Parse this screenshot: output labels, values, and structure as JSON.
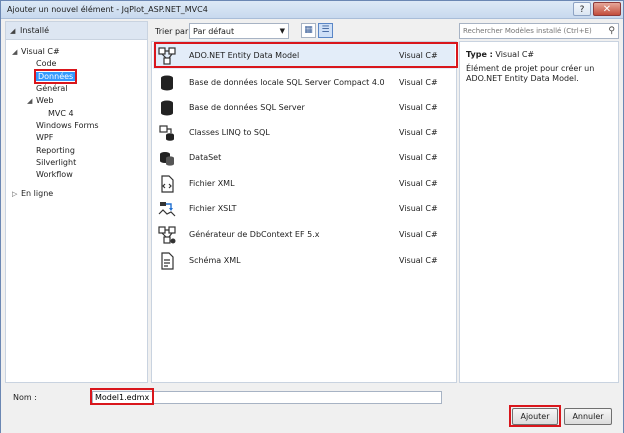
{
  "window": {
    "title": "Ajouter un nouvel élément - JqPlot_ASP.NET_MVC4",
    "help_label": "?",
    "close_label": "✕"
  },
  "tree": {
    "installed_label": "Installé",
    "items": [
      {
        "label": "Visual C#",
        "level": 1,
        "arrow": "◢"
      },
      {
        "label": "Code",
        "level": 2
      },
      {
        "label": "Données",
        "level": 2,
        "selected": true
      },
      {
        "label": "Général",
        "level": 2
      },
      {
        "label": "Web",
        "level": 2,
        "arrow": "◢"
      },
      {
        "label": "MVC 4",
        "level": 3
      },
      {
        "label": "Windows Forms",
        "level": 2
      },
      {
        "label": "WPF",
        "level": 2
      },
      {
        "label": "Reporting",
        "level": 2
      },
      {
        "label": "Silverlight",
        "level": 2
      },
      {
        "label": "Workflow",
        "level": 2
      }
    ],
    "online_label": "En ligne"
  },
  "sort": {
    "label": "Trier par :",
    "value": "Par défaut"
  },
  "templates": [
    {
      "name": "ADO.NET Entity Data Model",
      "lang": "Visual C#",
      "icon": "entity-model-icon"
    },
    {
      "name": "Base de données locale SQL Server Compact 4.0",
      "lang": "Visual C#",
      "icon": "database-icon"
    },
    {
      "name": "Base de données SQL Server",
      "lang": "Visual C#",
      "icon": "database-icon"
    },
    {
      "name": "Classes LINQ to SQL",
      "lang": "Visual C#",
      "icon": "linq-classes-icon"
    },
    {
      "name": "DataSet",
      "lang": "Visual C#",
      "icon": "dataset-icon"
    },
    {
      "name": "Fichier XML",
      "lang": "Visual C#",
      "icon": "xml-file-icon"
    },
    {
      "name": "Fichier XSLT",
      "lang": "Visual C#",
      "icon": "xslt-file-icon"
    },
    {
      "name": "Générateur de DbContext EF 5.x",
      "lang": "Visual C#",
      "icon": "dbcontext-generator-icon"
    },
    {
      "name": "Schéma XML",
      "lang": "Visual C#",
      "icon": "xml-schema-icon"
    }
  ],
  "search": {
    "placeholder": "Rechercher Modèles installé (Ctrl+E)"
  },
  "description": {
    "type_label": "Type :",
    "type_value": "Visual C#",
    "text": "Élément de projet pour créer un ADO.NET Entity Data Model."
  },
  "bottom": {
    "name_label": "Nom :",
    "name_value": "Model1.edmx",
    "add_label": "Ajouter",
    "cancel_label": "Annuler"
  }
}
